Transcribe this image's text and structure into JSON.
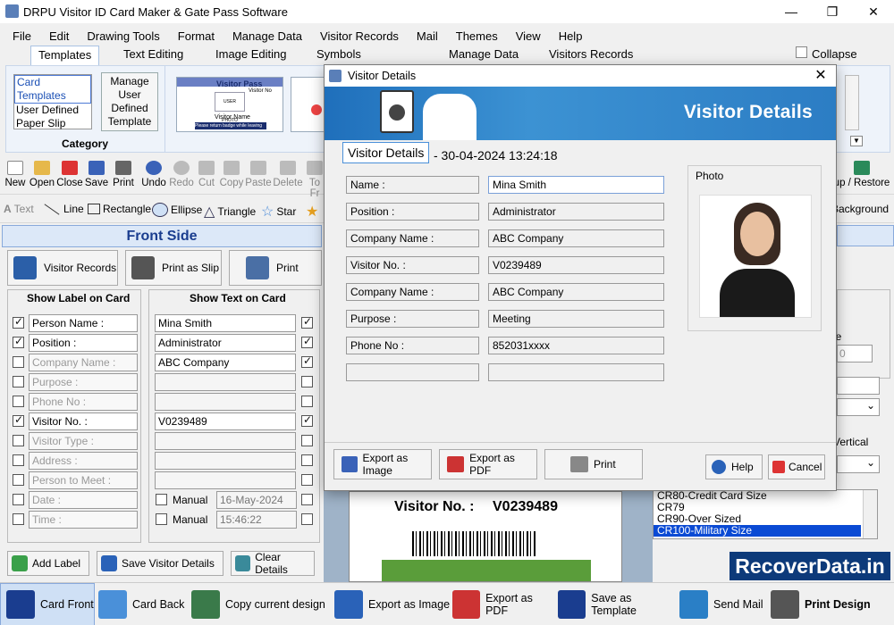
{
  "window": {
    "title": "DRPU Visitor ID Card Maker & Gate Pass Software",
    "minimize": "—",
    "restore": "❐",
    "close": "✕"
  },
  "menu": [
    "File",
    "Edit",
    "Drawing Tools",
    "Format",
    "Manage Data",
    "Visitor Records",
    "Mail",
    "Themes",
    "View",
    "Help"
  ],
  "ribbon_tabs": [
    "Templates",
    "Text Editing",
    "Image Editing",
    "Symbols",
    "Manage Data",
    "Visitors Records"
  ],
  "collapse_label": "Collapse",
  "category": {
    "items": [
      "Card Templates",
      "User Defined",
      "Paper Slip"
    ],
    "manage_button": "Manage User Defined Template",
    "group_label": "Category"
  },
  "template_preview": {
    "title": "Visitor Pass",
    "visitor_no": "Visitor No",
    "name": "Visitor Name",
    "photo": "USER PHOTO",
    "note": "Please return badge while leaving"
  },
  "toolbar": [
    "New",
    "Open",
    "Close",
    "Save",
    "Print",
    "Undo",
    "Redo",
    "Cut",
    "Copy",
    "Paste",
    "Delete",
    "To Fr"
  ],
  "toolbar_right": "up / Restore",
  "drawing_tools": [
    "Text",
    "Line",
    "Rectangle",
    "Ellipse",
    "Triangle",
    "Star"
  ],
  "drawing_right": "Background",
  "front_side": {
    "header": "Front Side",
    "buttons": [
      "Visitor Records",
      "Print as Slip",
      "Print"
    ],
    "show_label_header": "Show Label on Card",
    "show_text_header": "Show Text on Card",
    "rows": [
      {
        "label": "Person Name :",
        "label_checked": true,
        "value": "Mina Smith",
        "value_checked": true,
        "enabled": true
      },
      {
        "label": "Position :",
        "label_checked": true,
        "value": "Administrator",
        "value_checked": true,
        "enabled": true
      },
      {
        "label": "Company Name :",
        "label_checked": false,
        "value": "ABC Company",
        "value_checked": true,
        "enabled": false
      },
      {
        "label": "Purpose :",
        "label_checked": false,
        "value": "",
        "value_checked": false,
        "enabled": false
      },
      {
        "label": "Phone No :",
        "label_checked": false,
        "value": "",
        "value_checked": false,
        "enabled": false
      },
      {
        "label": "Visitor No. :",
        "label_checked": true,
        "value": "V0239489",
        "value_checked": true,
        "enabled": true
      },
      {
        "label": "Visitor Type :",
        "label_checked": false,
        "value": "",
        "value_checked": false,
        "enabled": false
      },
      {
        "label": "Address :",
        "label_checked": false,
        "value": "",
        "value_checked": false,
        "enabled": false
      },
      {
        "label": "Person to Meet :",
        "label_checked": false,
        "value": "",
        "value_checked": false,
        "enabled": false
      },
      {
        "label": "Date :",
        "label_checked": false,
        "value": "",
        "value_checked": false,
        "enabled": false
      },
      {
        "label": "Time :",
        "label_checked": false,
        "value": "",
        "value_checked": false,
        "enabled": false
      }
    ],
    "date_manual": {
      "label": "Manual",
      "value": "16-May-2024"
    },
    "time_manual": {
      "label": "Manual",
      "value": "15:46:22"
    },
    "bottom_buttons": [
      "Add Label",
      "Save Visitor Details",
      "Clear Details"
    ]
  },
  "right_panel": {
    "partial_label_le": "le",
    "partial_value": "0",
    "vertical": "Vertical",
    "sizes": [
      "CR80-Credit Card Size",
      "CR79",
      "CR90-Over Sized",
      "CR100-Military Size"
    ],
    "selected_size": "CR100-Military Size"
  },
  "card_preview": {
    "visitor_no_label": "Visitor No. :",
    "visitor_no": "V0239489"
  },
  "watermark": "RecoverData.in",
  "bottom_bar": [
    "Card Front",
    "Card Back",
    "Copy current design",
    "Export as Image",
    "Export as PDF",
    "Save as Template",
    "Send Mail",
    "Print Design"
  ],
  "dialog": {
    "title": "Visitor Details",
    "banner": "Visitor Details",
    "heading": "Visitor Details",
    "datetime": "- 30-04-2024 13:24:18",
    "photo_label": "Photo",
    "fields": [
      {
        "label": "Name :",
        "value": "Mina Smith"
      },
      {
        "label": "Position :",
        "value": "Administrator"
      },
      {
        "label": "Company Name :",
        "value": "ABC Company"
      },
      {
        "label": "Visitor No. :",
        "value": "V0239489"
      },
      {
        "label": "Company Name :",
        "value": "ABC Company"
      },
      {
        "label": "Purpose :",
        "value": "Meeting"
      },
      {
        "label": "Phone No :",
        "value": "852031xxxx"
      },
      {
        "label": "",
        "value": ""
      }
    ],
    "buttons": [
      "Export as Image",
      "Export as PDF",
      "Print",
      "Help",
      "Cancel"
    ]
  },
  "colors": {
    "accent": "#1a3d8f",
    "banner": "#2a7fc6",
    "card_green": "#5a9d3a"
  }
}
